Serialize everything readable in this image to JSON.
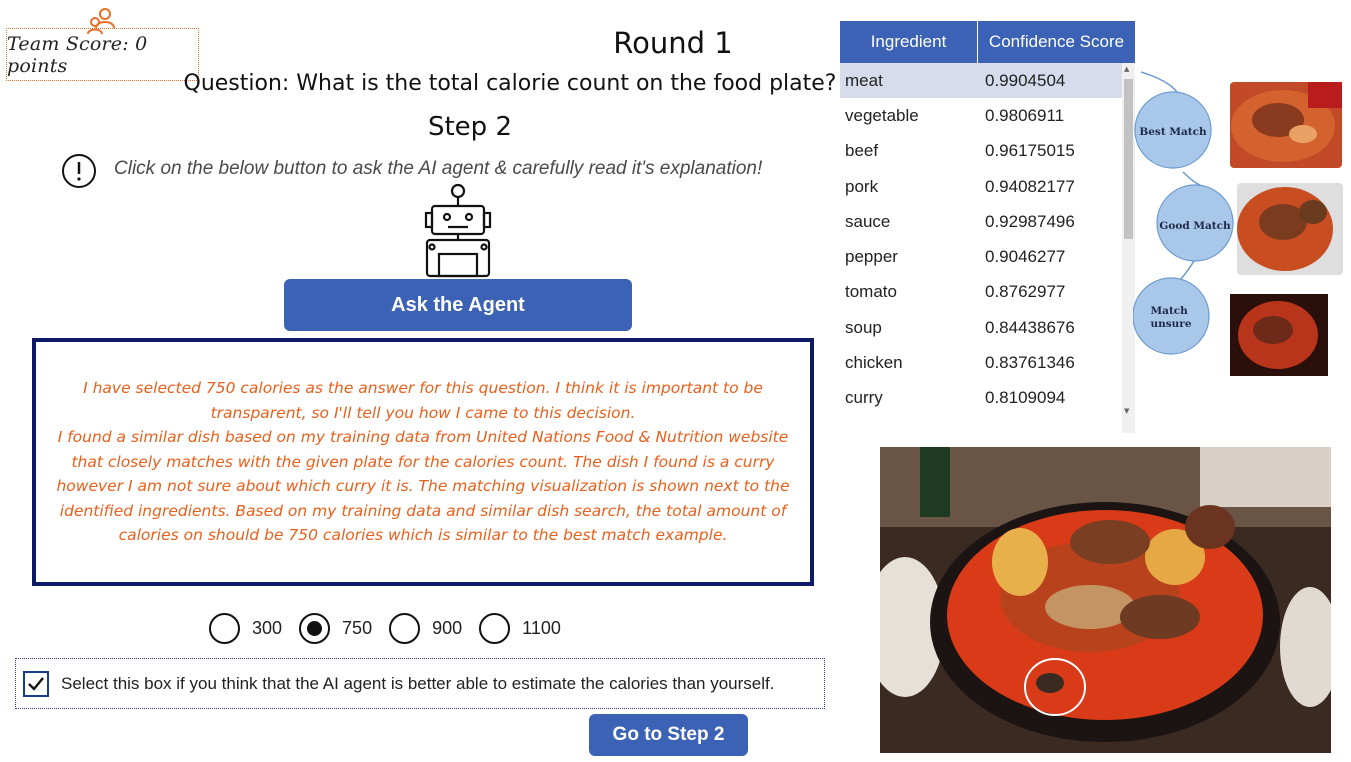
{
  "header": {
    "team_score": "Team Score: 0 points",
    "round": "Round 1",
    "question": "Question: What is the total calorie count on the food plate?",
    "step": "Step 2",
    "instruction": "Click on the below button to ask the AI agent & carefully read it's explanation!"
  },
  "agent": {
    "ask_button": "Ask the Agent",
    "explanation": "I have selected 750 calories as the answer for this question. I think it is important to be transparent, so I'll tell you how I came to this decision.\nI found a similar dish based on my training data from United Nations Food & Nutrition website that closely matches with the given plate for the calories count. The dish I found is a curry however I am not sure about which curry it is. The matching visualization is shown next to the identified ingredients. Based on my training data and similar dish search, the total amount of calories on should be 750 calories which is similar to the best match example."
  },
  "answers": {
    "options": [
      "300",
      "750",
      "900",
      "1100"
    ],
    "selected": "750"
  },
  "ai_better": {
    "label": "Select this box if you think that the AI agent is better able to estimate the calories than yourself.",
    "checked": true
  },
  "navigation": {
    "next_button": "Go to Step 2"
  },
  "ingredients_table": {
    "headers": [
      "Ingredient",
      "Confidence Score"
    ],
    "rows": [
      [
        "meat",
        "0.9904504"
      ],
      [
        "vegetable",
        "0.9806911"
      ],
      [
        "beef",
        "0.96175015"
      ],
      [
        "pork",
        "0.94082177"
      ],
      [
        "sauce",
        "0.92987496"
      ],
      [
        "pepper",
        "0.9046277"
      ],
      [
        "tomato",
        "0.8762977"
      ],
      [
        "soup",
        "0.84438676"
      ],
      [
        "chicken",
        "0.83761346"
      ],
      [
        "curry",
        "0.8109094"
      ]
    ],
    "selected_row": 0
  },
  "match_visualization": {
    "labels": [
      "Best Match",
      "Good Match",
      "Match unsure"
    ]
  },
  "colors": {
    "accent_blue": "#3b62b5",
    "orange": "#e8601c",
    "box_border": "#0d1a66",
    "node_blue": "#a9c7e8"
  }
}
